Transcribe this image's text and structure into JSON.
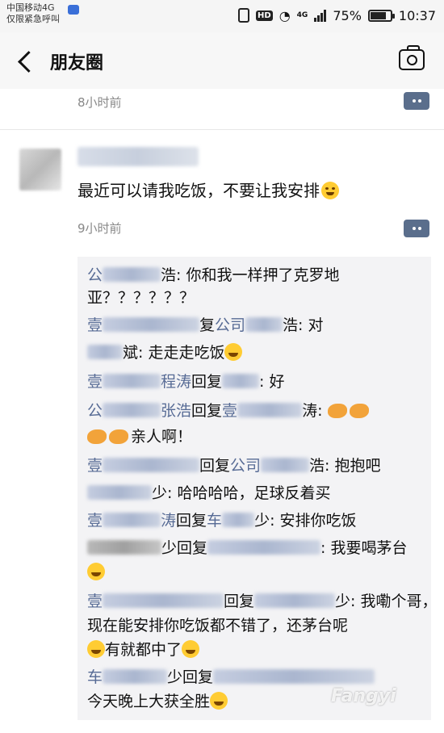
{
  "status_bar": {
    "carrier_line1": "中国移动4G",
    "carrier_line2": "仅限紧急呼叫",
    "network": "4G",
    "battery": "75%",
    "time": "10:37"
  },
  "header": {
    "title": "朋友圈"
  },
  "previous_post": {
    "time": "8小时前"
  },
  "post": {
    "text": "最近可以请我吃饭，不要让我安排",
    "time": "9小时前"
  },
  "comments": [
    {
      "text": "浩: 你和我一样押了克罗地"
    },
    {
      "text": "亚？？？？？？"
    },
    {
      "reply_word": "复",
      "name_tail": "公司",
      "text": "浩: 对"
    },
    {
      "text": "斌: 走走走吃饭"
    },
    {
      "name": "壹",
      "name_tail": "程涛",
      "reply_word": "回复",
      "text": ": 好"
    },
    {
      "name": "公",
      "name_tail": "张浩",
      "reply_word": "回复",
      "name2": "壹",
      "text": "涛: "
    },
    {
      "text": "亲人啊！"
    },
    {
      "name": "壹",
      "reply_word": "回复",
      "name2": "公司",
      "text": "浩: 抱抱吧"
    },
    {
      "text": "少: 哈哈哈哈，足球反着买"
    },
    {
      "name": "壹",
      "name_tail": "涛",
      "reply_word": "回复",
      "name2": "车",
      "text": "少: 安排你吃饭"
    },
    {
      "reply_word": "少回复",
      "text": ": 我要喝茅台"
    },
    {
      "reply_word": "回复",
      "text": "少: 我嘞个哥，"
    },
    {
      "text": "现在能安排你吃饭都不错了，还茅台呢"
    },
    {
      "text": "有就都中了"
    },
    {
      "name": "车",
      "reply_word": "少回复",
      "text": ""
    },
    {
      "text": "今天晚上大获全胜"
    }
  ],
  "watermark": "Fangyi"
}
